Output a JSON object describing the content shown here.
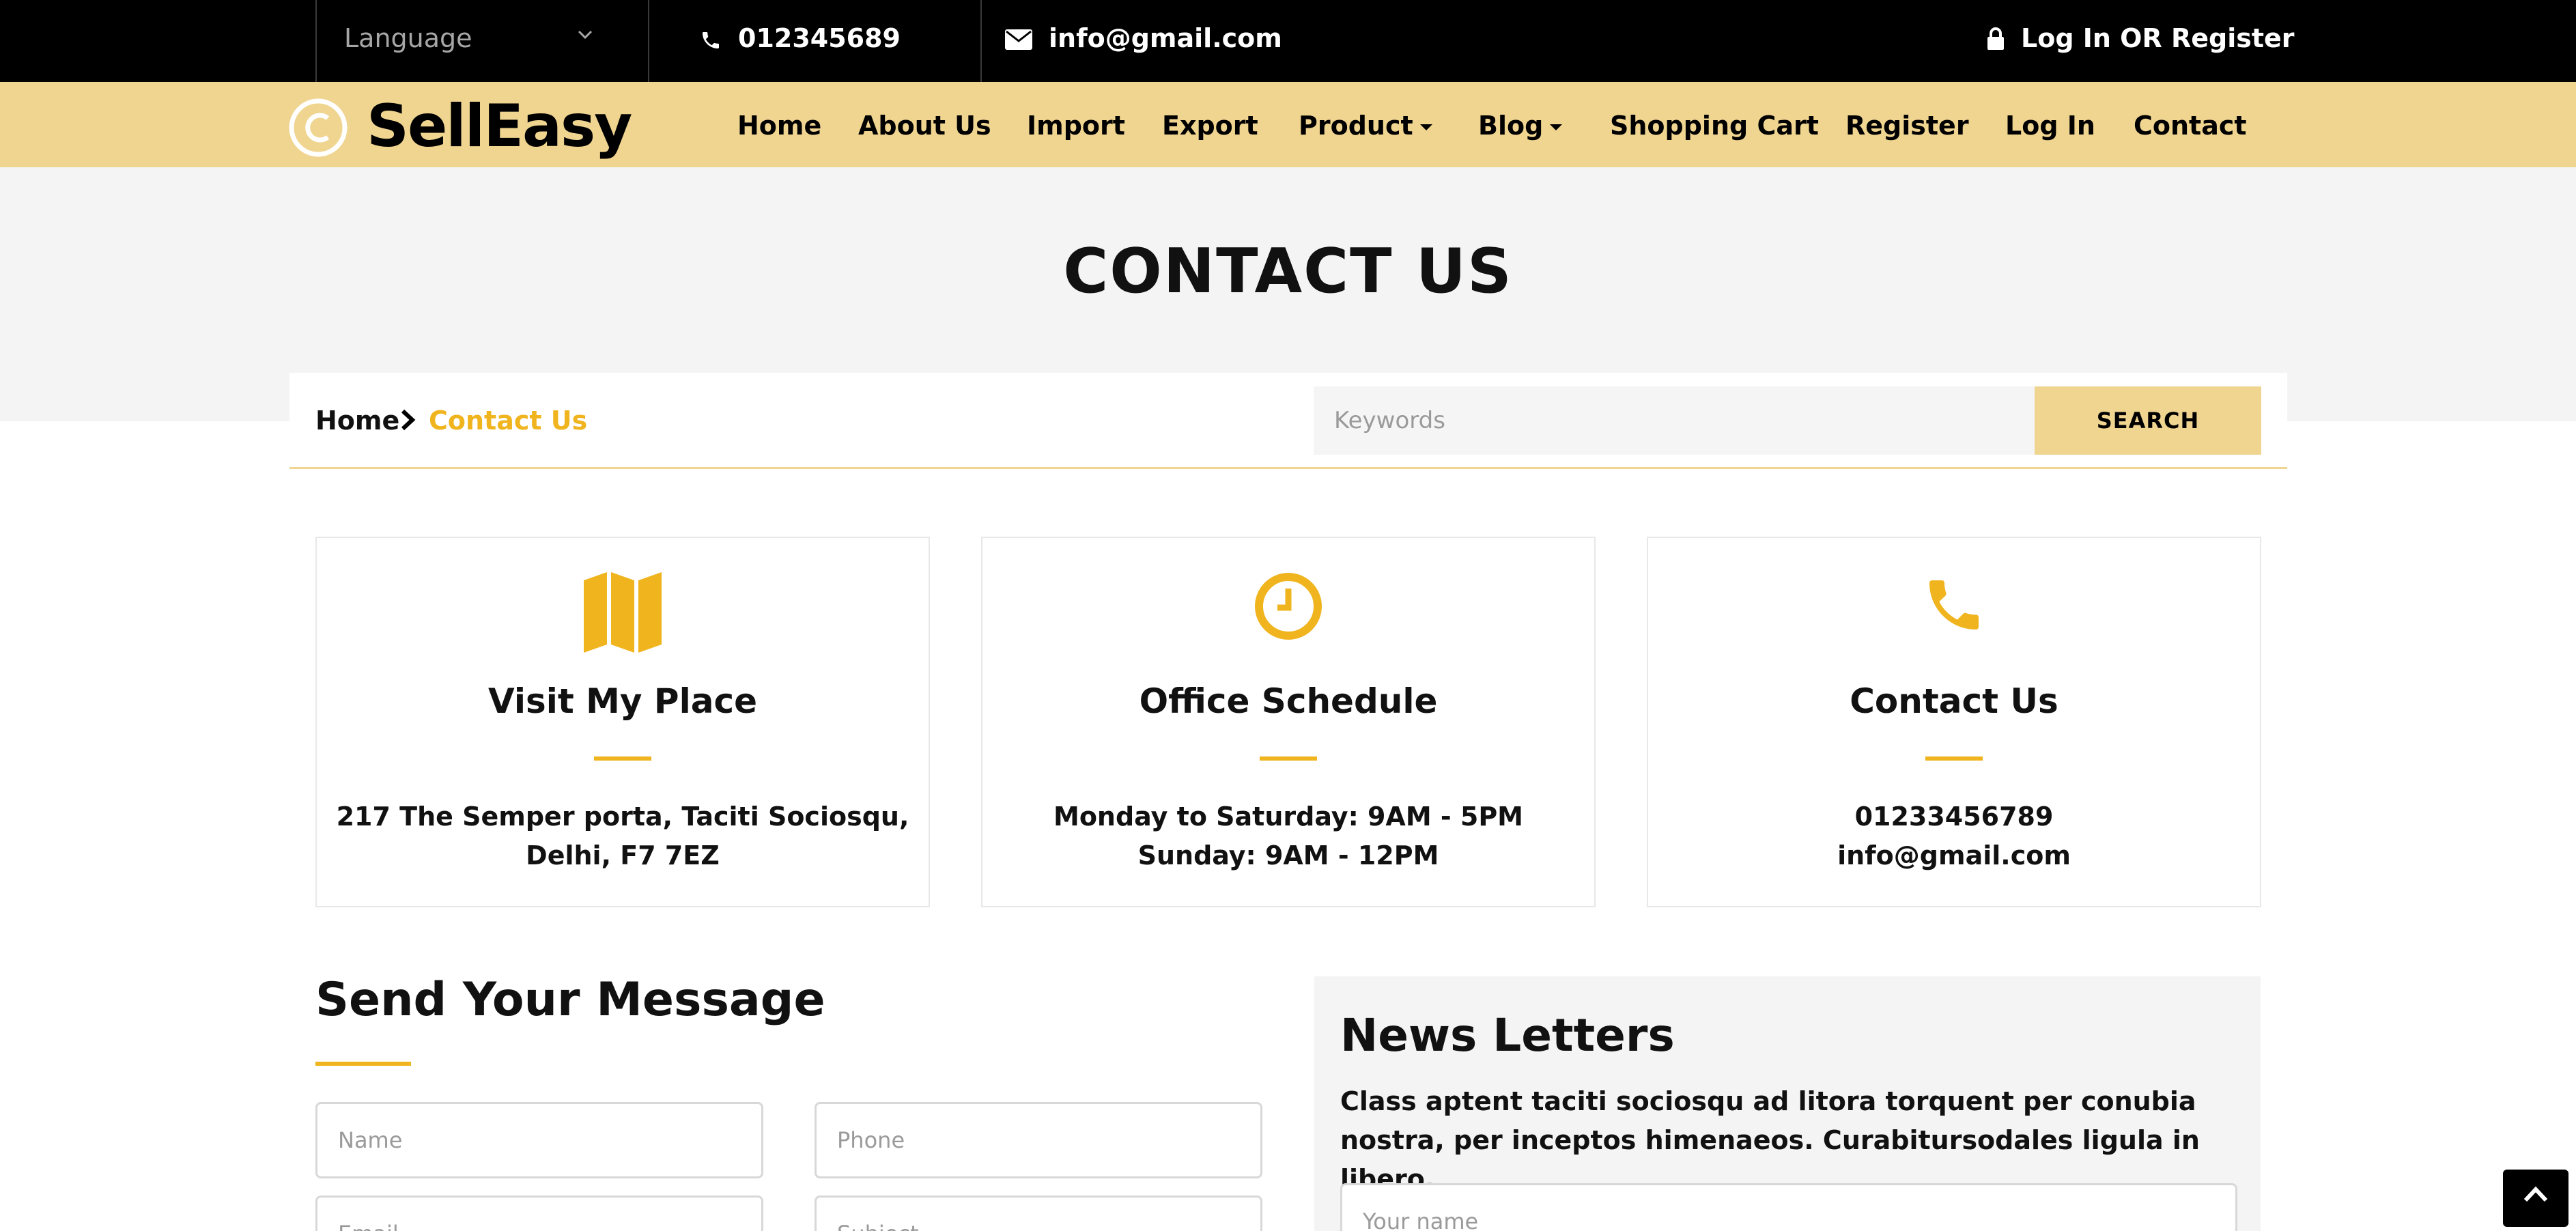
{
  "topbar": {
    "language_label": "Language",
    "phone": "012345689",
    "email": "info@gmail.com",
    "auth_text": "Log In OR Register"
  },
  "brand": {
    "name": "SellEasy",
    "accent": "#f0b41e",
    "nav_bg": "#f0d591"
  },
  "nav": {
    "items": [
      {
        "label": "Home",
        "dropdown": false
      },
      {
        "label": "About Us",
        "dropdown": false
      },
      {
        "label": "Import",
        "dropdown": false
      },
      {
        "label": "Export",
        "dropdown": false
      },
      {
        "label": "Product",
        "dropdown": true
      },
      {
        "label": "Blog",
        "dropdown": true
      },
      {
        "label": "Shopping Cart",
        "dropdown": false
      },
      {
        "label": "Register",
        "dropdown": false
      },
      {
        "label": "Log In",
        "dropdown": false
      },
      {
        "label": "Contact",
        "dropdown": false
      }
    ]
  },
  "page": {
    "title": "CONTACT US"
  },
  "breadcrumb": {
    "home": "Home",
    "current": "Contact Us"
  },
  "search": {
    "placeholder": "Keywords",
    "button": "SEARCH"
  },
  "cards": [
    {
      "icon": "map-icon",
      "title": "Visit My Place",
      "line1": "217 The Semper porta, Taciti Sociosqu,",
      "line2": "Delhi, F7 7EZ"
    },
    {
      "icon": "clock-icon",
      "title": "Office Schedule",
      "line1": "Monday to Saturday: 9AM - 5PM",
      "line2": "Sunday: 9AM - 12PM"
    },
    {
      "icon": "phone-icon",
      "title": "Contact Us",
      "line1": "01233456789",
      "line2": "info@gmail.com"
    }
  ],
  "message_form": {
    "heading": "Send Your Message",
    "name_placeholder": "Name",
    "phone_placeholder": "Phone",
    "email_placeholder": "Email",
    "subject_placeholder": "Subject"
  },
  "newsletter": {
    "heading": "News Letters",
    "text": "Class aptent taciti sociosqu ad litora torquent per conubia nostra, per inceptos himenaeos. Curabitursodales ligula in libero.",
    "name_placeholder": "Your name"
  }
}
